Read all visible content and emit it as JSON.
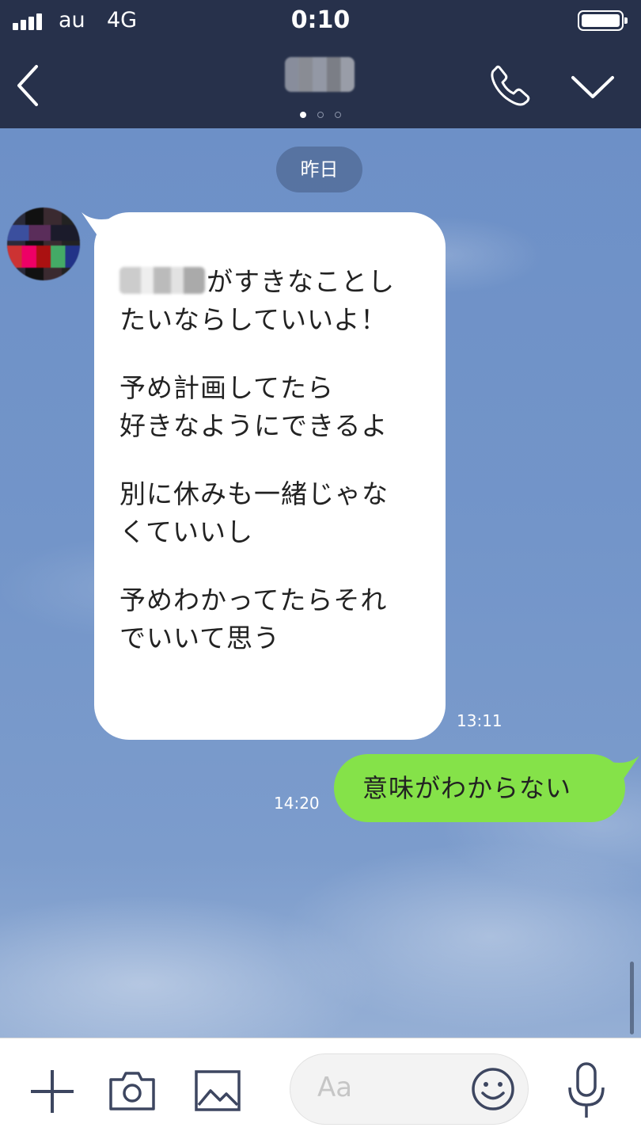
{
  "status_bar": {
    "carrier": "au",
    "network": "4G",
    "time": "0:10",
    "battery_level": 1.0
  },
  "header": {
    "title_pixelated": true,
    "page_dots": {
      "count": 3,
      "active_index": 0
    },
    "icons": [
      "back-chevron-icon",
      "phone-icon",
      "chevron-down-icon"
    ]
  },
  "chat": {
    "date_separator": "昨日",
    "messages": [
      {
        "side": "incoming",
        "avatar_pixelated": true,
        "lines": [
          [
            "がすきなことし",
            "たいならしていいよ！"
          ],
          [
            "予め計画してたら",
            "好きなようにできるよ"
          ],
          [
            "別に休みも一緒じゃな",
            "くていいし"
          ],
          [
            "予めわかってたらそれ",
            "でいいて思う"
          ]
        ],
        "time": "13:11"
      },
      {
        "side": "outgoing",
        "text": "意味がわからない",
        "time": "14:20"
      }
    ]
  },
  "toolbar": {
    "input_placeholder": "Aa",
    "icons": [
      "plus-icon",
      "camera-icon",
      "image-icon",
      "emoji-icon",
      "microphone-icon"
    ]
  },
  "colors": {
    "header_bg": "#27314b",
    "chat_bg": "#7395c9",
    "outgoing_bubble": "#85e249",
    "incoming_bubble": "#ffffff"
  }
}
